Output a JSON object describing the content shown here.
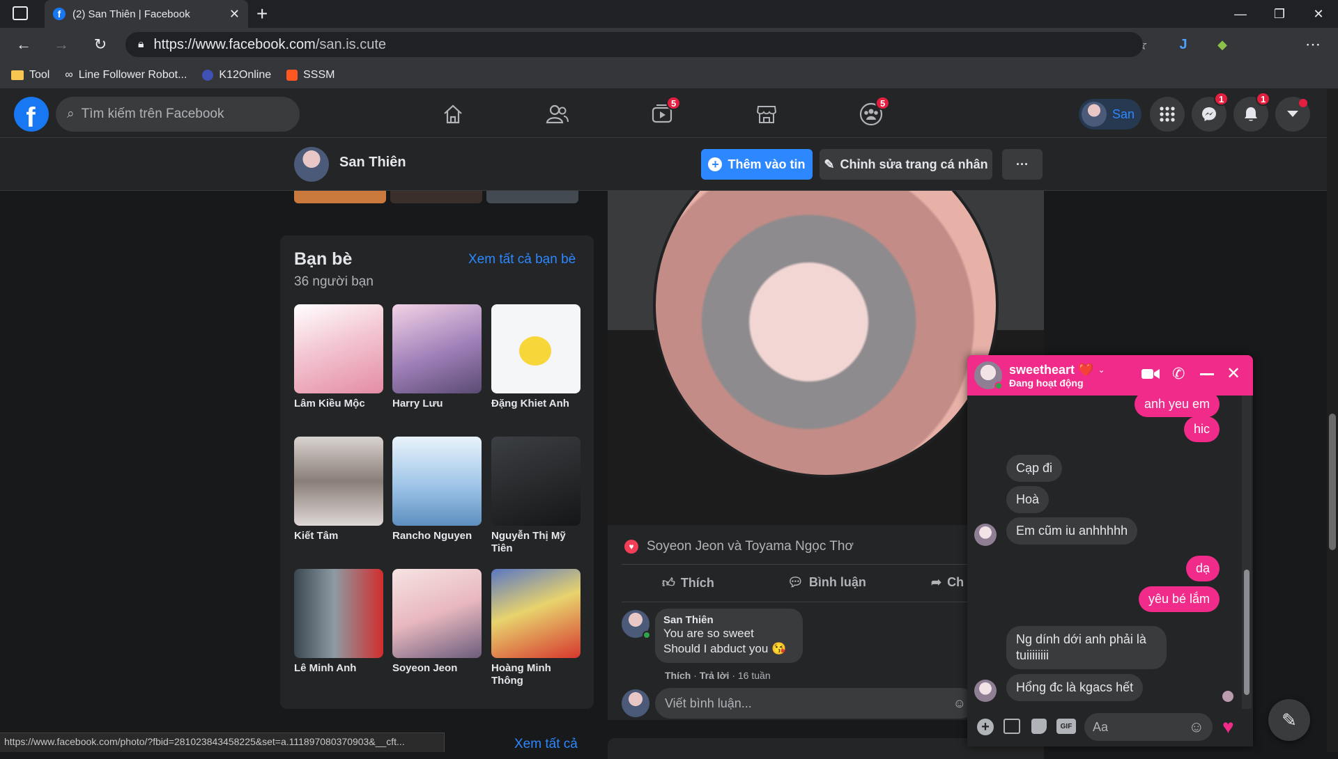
{
  "browser": {
    "tab_title": "(2) San Thiên | Facebook",
    "url_prefix": "https://www.",
    "url_domain": "facebook.com",
    "url_path": "/san.is.cute",
    "bookmarks": [
      "Tool",
      "Line Follower Robot...",
      "K12Online",
      "SSSM"
    ],
    "status_url": "https://www.facebook.com/photo/?fbid=281023843458225&set=a.111897080370903&__cft..."
  },
  "fbnav": {
    "search_placeholder": "Tìm kiếm trên Facebook",
    "watch_badge": "5",
    "groups_badge": "5",
    "profile_name": "San",
    "messenger_badge": "1",
    "notif_badge": "1"
  },
  "profile_header": {
    "name": "San Thiên",
    "add_story": "Thêm vào tin",
    "edit_profile": "Chỉnh sửa trang cá nhân",
    "more": "···"
  },
  "friends": {
    "title": "Bạn bè",
    "see_all": "Xem tất cả bạn bè",
    "count": "36 người bạn",
    "items": [
      {
        "name": "Lâm Kiều Mộc",
        "color": "#f3c6d3"
      },
      {
        "name": "Harry Lưu",
        "color": "#c9a6d6"
      },
      {
        "name": "Đặng Khiet Anh",
        "color": "#f4f6f8"
      },
      {
        "name": "Kiết Tâm",
        "color": "#bdb3ae"
      },
      {
        "name": "Rancho Nguyen",
        "color": "#9fc5e8"
      },
      {
        "name": "Nguyễn Thị Mỹ Tiên",
        "color": "#2a2c2e"
      },
      {
        "name": "Lê Minh Anh",
        "color": "#6e7c86"
      },
      {
        "name": "Soyeon Jeon",
        "color": "#e8c6c9"
      },
      {
        "name": "Hoàng Minh Thông",
        "color": "#e34a3a"
      }
    ],
    "see_all_photos": "Xem tất cả"
  },
  "post": {
    "reactions_text": "Soyeon Jeon và Toyama Ngọc Thơ",
    "like": "Thích",
    "comment": "Bình luận",
    "share": "Ch",
    "comment_author": "San Thiên",
    "comment_line1": "You are so sweet",
    "comment_line2": "Should I abduct you 😘",
    "comment_meta_like": "Thích",
    "comment_meta_reply": "Trả lời",
    "comment_meta_time": "16 tuần",
    "write_comment": "Viết bình luận..."
  },
  "chat": {
    "name": "sweetheart ❤️",
    "status": "Đang hoạt động",
    "messages": [
      {
        "dir": "out",
        "text": "anh yeu em"
      },
      {
        "dir": "out",
        "text": "hic"
      },
      {
        "dir": "in",
        "text": "Cạp đi"
      },
      {
        "dir": "in",
        "text": "Hoà"
      },
      {
        "dir": "in",
        "text": "Em cũm iu anhhhhh"
      },
      {
        "dir": "out",
        "text": "dạ"
      },
      {
        "dir": "out",
        "text": "yêu bé lắm"
      },
      {
        "dir": "in",
        "text": "Ng dính dới anh phải là tuiiiiiiii"
      },
      {
        "dir": "in",
        "text": "Hổng đc là kgacs hết"
      }
    ],
    "input_placeholder": "Aa"
  }
}
